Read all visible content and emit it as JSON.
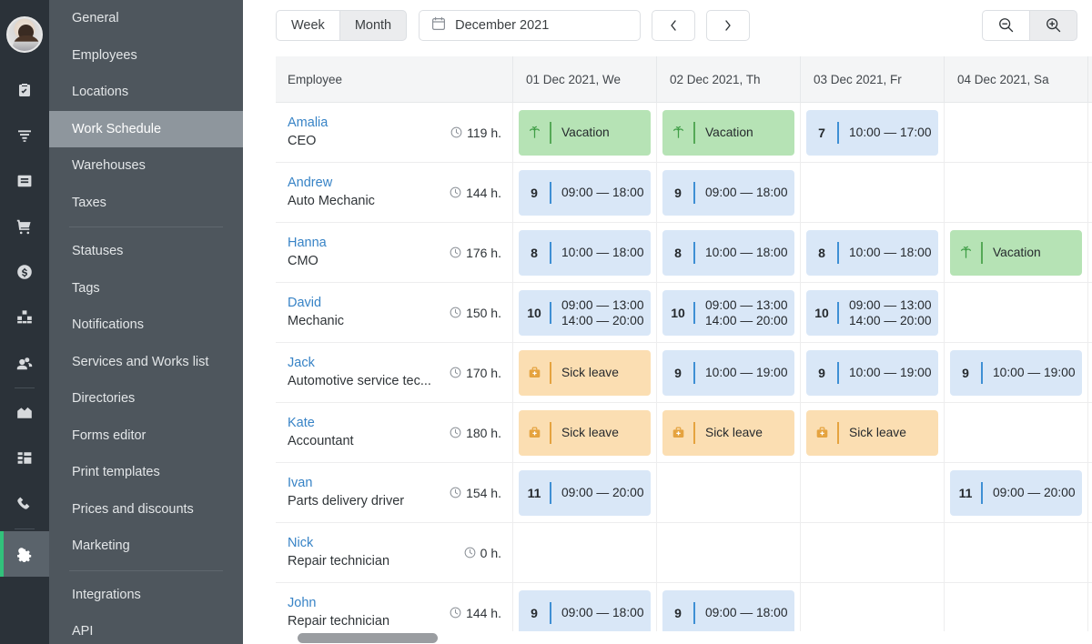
{
  "rail": {
    "avatar_alt": "user-avatar",
    "icons": [
      {
        "name": "clipboard-check-icon",
        "active": false
      },
      {
        "name": "funnel-filter-icon",
        "active": false
      },
      {
        "name": "inbox-icon",
        "active": false
      },
      {
        "name": "shopping-cart-icon",
        "active": false
      },
      {
        "name": "dollar-coin-icon",
        "active": false
      },
      {
        "name": "boxes-icon",
        "active": false
      },
      {
        "name": "people-icon",
        "active": false
      },
      {
        "name": "chart-area-icon",
        "active": false
      },
      {
        "name": "dashboard-grid-icon",
        "active": false
      },
      {
        "name": "phone-icon",
        "active": false
      },
      {
        "name": "gear-icon",
        "active": true
      }
    ]
  },
  "menu": {
    "items": [
      {
        "label": "General",
        "selected": false,
        "divider_after": false
      },
      {
        "label": "Employees",
        "selected": false,
        "divider_after": false
      },
      {
        "label": "Locations",
        "selected": false,
        "divider_after": false
      },
      {
        "label": "Work Schedule",
        "selected": true,
        "divider_after": false
      },
      {
        "label": "Warehouses",
        "selected": false,
        "divider_after": false
      },
      {
        "label": "Taxes",
        "selected": false,
        "divider_after": true
      },
      {
        "label": "Statuses",
        "selected": false,
        "divider_after": false
      },
      {
        "label": "Tags",
        "selected": false,
        "divider_after": false
      },
      {
        "label": "Notifications",
        "selected": false,
        "divider_after": false
      },
      {
        "label": "Services and Works list",
        "selected": false,
        "divider_after": false
      },
      {
        "label": "Directories",
        "selected": false,
        "divider_after": false
      },
      {
        "label": "Forms editor",
        "selected": false,
        "divider_after": false
      },
      {
        "label": "Print templates",
        "selected": false,
        "divider_after": false
      },
      {
        "label": "Prices and discounts",
        "selected": false,
        "divider_after": false
      },
      {
        "label": "Marketing",
        "selected": false,
        "divider_after": true
      },
      {
        "label": "Integrations",
        "selected": false,
        "divider_after": false
      },
      {
        "label": "API",
        "selected": false,
        "divider_after": false
      }
    ]
  },
  "toolbar": {
    "week_label": "Week",
    "month_label": "Month",
    "active_view": "Month",
    "date_label": "December 2021",
    "calendar_icon": "calendar-icon",
    "prev_label": "‹",
    "next_label": "›",
    "zoom_out_icon": "zoom-out-icon",
    "zoom_in_icon": "zoom-in-icon"
  },
  "grid": {
    "employee_header": "Employee",
    "day_headers": [
      "01 Dec 2021, We",
      "02 Dec 2021, Th",
      "03 Dec 2021, Fr",
      "04 Dec 2021, Sa"
    ],
    "clock_icon": "clock-icon",
    "rows": [
      {
        "name": "Amalia",
        "role": "CEO",
        "hours": "119 h.",
        "days": [
          {
            "type": "vacation",
            "label": "Vacation"
          },
          {
            "type": "vacation",
            "label": "Vacation"
          },
          {
            "type": "shift",
            "hours": "7",
            "times": [
              "10:00 — 17:00"
            ]
          },
          {
            "type": "empty"
          }
        ]
      },
      {
        "name": "Andrew",
        "role": "Auto Mechanic",
        "hours": "144 h.",
        "days": [
          {
            "type": "shift",
            "hours": "9",
            "times": [
              "09:00 — 18:00"
            ]
          },
          {
            "type": "shift",
            "hours": "9",
            "times": [
              "09:00 — 18:00"
            ]
          },
          {
            "type": "empty"
          },
          {
            "type": "empty"
          }
        ]
      },
      {
        "name": "Hanna",
        "role": "CMO",
        "hours": "176 h.",
        "days": [
          {
            "type": "shift",
            "hours": "8",
            "times": [
              "10:00 — 18:00"
            ]
          },
          {
            "type": "shift",
            "hours": "8",
            "times": [
              "10:00 — 18:00"
            ]
          },
          {
            "type": "shift",
            "hours": "8",
            "times": [
              "10:00 — 18:00"
            ]
          },
          {
            "type": "vacation",
            "label": "Vacation"
          }
        ]
      },
      {
        "name": "David",
        "role": "Mechanic",
        "hours": "150 h.",
        "days": [
          {
            "type": "shift",
            "hours": "10",
            "times": [
              "09:00 — 13:00",
              "14:00 — 20:00"
            ]
          },
          {
            "type": "shift",
            "hours": "10",
            "times": [
              "09:00 — 13:00",
              "14:00 — 20:00"
            ]
          },
          {
            "type": "shift",
            "hours": "10",
            "times": [
              "09:00 — 13:00",
              "14:00 — 20:00"
            ]
          },
          {
            "type": "empty"
          }
        ]
      },
      {
        "name": "Jack",
        "role": "Automotive service tec...",
        "hours": "170 h.",
        "days": [
          {
            "type": "sick",
            "label": "Sick leave"
          },
          {
            "type": "shift",
            "hours": "9",
            "times": [
              "10:00 — 19:00"
            ]
          },
          {
            "type": "shift",
            "hours": "9",
            "times": [
              "10:00 — 19:00"
            ]
          },
          {
            "type": "shift",
            "hours": "9",
            "times": [
              "10:00 — 19:00"
            ]
          }
        ]
      },
      {
        "name": "Kate",
        "role": "Accountant",
        "hours": "180 h.",
        "days": [
          {
            "type": "sick",
            "label": "Sick leave"
          },
          {
            "type": "sick",
            "label": "Sick leave"
          },
          {
            "type": "sick",
            "label": "Sick leave"
          },
          {
            "type": "empty"
          }
        ]
      },
      {
        "name": "Ivan",
        "role": "Parts delivery driver",
        "hours": "154 h.",
        "days": [
          {
            "type": "shift",
            "hours": "11",
            "times": [
              "09:00 — 20:00"
            ]
          },
          {
            "type": "empty"
          },
          {
            "type": "empty"
          },
          {
            "type": "shift",
            "hours": "11",
            "times": [
              "09:00 — 20:00"
            ]
          }
        ]
      },
      {
        "name": "Nick",
        "role": "Repair technician",
        "hours": "0 h.",
        "days": [
          {
            "type": "empty"
          },
          {
            "type": "empty"
          },
          {
            "type": "empty"
          },
          {
            "type": "empty"
          }
        ]
      },
      {
        "name": "John",
        "role": "Repair technician",
        "hours": "144 h.",
        "days": [
          {
            "type": "shift",
            "hours": "9",
            "times": [
              "09:00 — 18:00"
            ]
          },
          {
            "type": "shift",
            "hours": "9",
            "times": [
              "09:00 — 18:00"
            ]
          },
          {
            "type": "empty"
          },
          {
            "type": "empty"
          }
        ]
      }
    ]
  },
  "colors": {
    "shift_bg": "#d9e7f7",
    "shift_bar": "#3e8fd4",
    "vacation_bg": "#b6e3b5",
    "vacation_bar": "#55a956",
    "sick_bg": "#fbdeb2",
    "sick_bar": "#e5a33f",
    "link": "#3783c6",
    "rail_bg": "#2b3239",
    "menu_bg": "#4e565d",
    "menu_selected": "#8e969d",
    "accent_green": "#32c17b"
  }
}
